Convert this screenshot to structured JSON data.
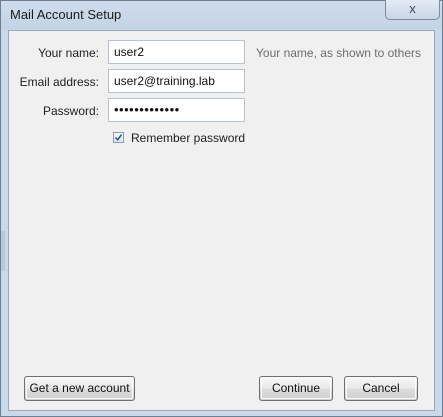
{
  "window": {
    "title": "Mail Account Setup",
    "close_glyph": "x"
  },
  "form": {
    "name": {
      "label": "Your name:",
      "value": "user2",
      "hint": "Your name, as shown to others"
    },
    "email": {
      "label": "Email address:",
      "value": "user2@training.lab"
    },
    "password": {
      "label": "Password:",
      "masked_value": "•••••••••••••"
    },
    "remember_password": {
      "label": "Remember password",
      "checked": true
    }
  },
  "buttons": {
    "new_account": "Get a new account",
    "continue": "Continue",
    "cancel": "Cancel"
  },
  "colors": {
    "window_frame": "#c9d8ea",
    "dialog_background": "#f0f0f0",
    "hint_text": "#6d6d6d",
    "checkbox_check": "#2a5aa8"
  },
  "icons": {
    "close": "close-icon",
    "checkbox_check": "checkmark-icon"
  }
}
